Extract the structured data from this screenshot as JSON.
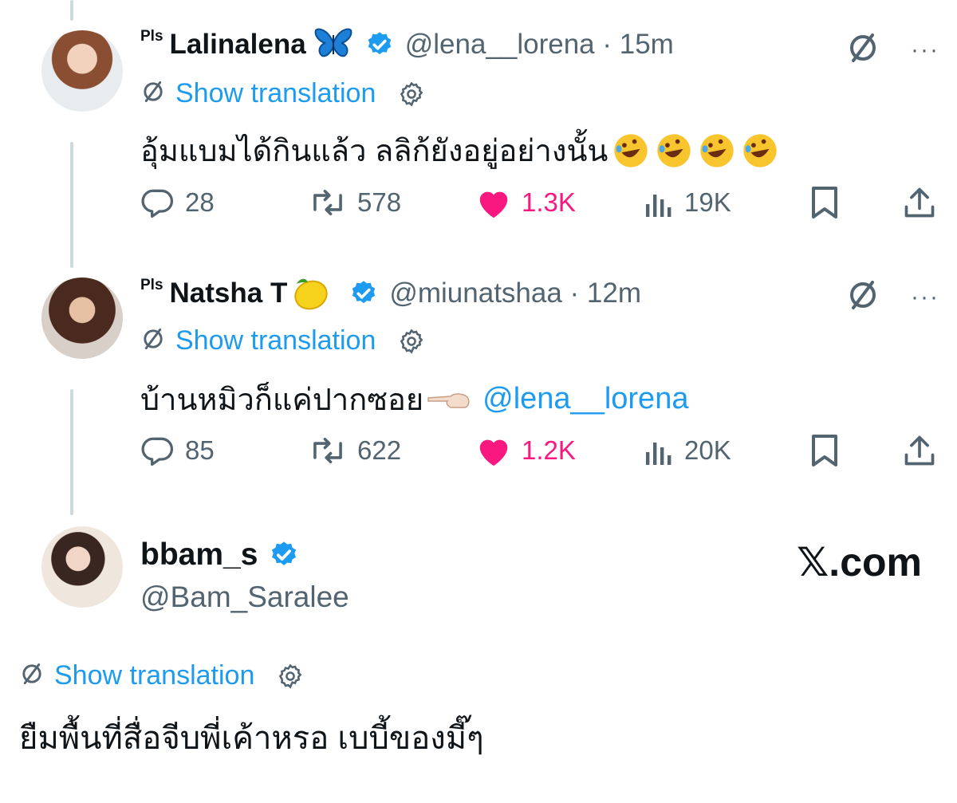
{
  "colors": {
    "accent": "#1d9bf0",
    "like": "#f91880",
    "muted": "#536471",
    "text": "#0f1419"
  },
  "tweets": [
    {
      "badge": "Pls",
      "name": "Lalinalena",
      "emoji": "butterfly",
      "handle_time": "@lena__lorena · 15m",
      "translation": "Show translation",
      "text": "อุ้มแบมได้กินแล้ว ลลิก้ยังอยู่อย่างนั้น",
      "reply_emojis": "rofl x4",
      "mention": "",
      "stats": {
        "replies": "28",
        "reposts": "578",
        "likes": "1.3K",
        "views": "19K"
      }
    },
    {
      "badge": "Pls",
      "name": "Natsha T",
      "emoji": "lemon",
      "handle_time": "@miunatshaa · 12m",
      "translation": "Show translation",
      "text": "บ้านหมิวก็แค่ปากซอย",
      "mention": "@lena__lorena",
      "stats": {
        "replies": "85",
        "reposts": "622",
        "likes": "1.2K",
        "views": "20K"
      }
    }
  ],
  "main": {
    "name": "bbam_s",
    "handle": "@Bam_Saralee",
    "brand": "𝕏.com",
    "translation": "Show translation",
    "text": "ยืมพื้นที่สื่อจีบพี่เค้าหรอ เบบี้ของมี๊ๆ"
  },
  "menu_more": "···"
}
